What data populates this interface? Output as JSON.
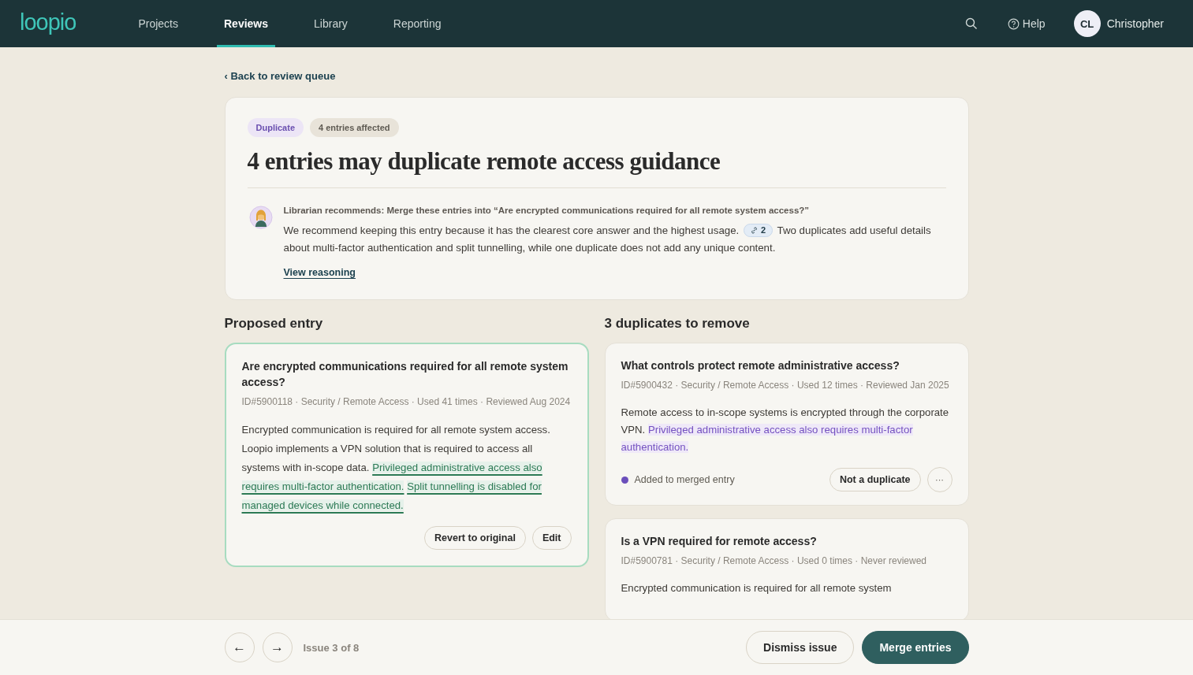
{
  "nav": {
    "logo": "loopio",
    "items": [
      {
        "label": "Projects",
        "selected": false
      },
      {
        "label": "Reviews",
        "selected": true
      },
      {
        "label": "Library",
        "selected": false
      },
      {
        "label": "Reporting",
        "selected": false
      }
    ],
    "help": "Help",
    "user": {
      "initials": "CL",
      "name": "Christopher"
    }
  },
  "back_link": "‹ Back to review queue",
  "issue": {
    "tags": [
      {
        "label": "Duplicate",
        "kind": "type"
      },
      {
        "label": "4 entries affected",
        "kind": "count"
      }
    ],
    "title": "4 entries may duplicate remote access guidance",
    "recommendation": {
      "heading": "Librarian recommends: Merge these entries into “Are encrypted communications required for all remote system access?”",
      "text_before": "We recommend keeping this entry because it has the clearest core answer and the highest usage.",
      "citation": "2",
      "text_after": "Two duplicates add useful details about multi-factor authentication and split tunnelling, while one duplicate does not add any unique content.",
      "link": "View reasoning"
    }
  },
  "proposed": {
    "heading": "Proposed entry",
    "title": "Are encrypted communications required for all remote system access?",
    "meta": "ID#5900118 · Security / Remote Access · Used 41 times · Reviewed Aug 2024",
    "body": [
      {
        "text": "Encrypted communication is required for all remote system access. Loopio implements a VPN solution that is required to access all systems with in-scope data.",
        "kind": "plain"
      },
      {
        "text": "Privileged administrative access also requires multi-factor authentication.",
        "kind": "added"
      },
      {
        "text": "Split tunnelling is disabled for managed devices while connected.",
        "kind": "added"
      }
    ],
    "buttons": [
      "Revert to original",
      "Edit"
    ]
  },
  "duplicates": {
    "heading": "3 duplicates to remove",
    "items": [
      {
        "title": "What controls protect remote administrative access?",
        "meta": "ID#5900432 · Security / Remote Access · Used 12 times · Reviewed Jan 2025",
        "body": [
          {
            "text": "Remote access to in-scope systems is encrypted through the corporate VPN.",
            "kind": "plain"
          },
          {
            "text": "Privileged administrative access also requires multi-factor authentication.",
            "kind": "merged"
          }
        ],
        "status": {
          "label": "Added to merged entry",
          "color": "#6b4fbb"
        },
        "button": "Not a duplicate",
        "more": "···"
      },
      {
        "title": "Is a VPN required for remote access?",
        "meta": "ID#5900781 · Security / Remote Access · Used 0 times · Never reviewed",
        "body": [
          {
            "text": "Encrypted communication is required for all remote system",
            "kind": "plain"
          }
        ]
      }
    ]
  },
  "footer": {
    "prev": "←",
    "next": "→",
    "position": "Issue 3 of 8",
    "dismiss": "Dismiss issue",
    "merge": "Merge entries"
  }
}
